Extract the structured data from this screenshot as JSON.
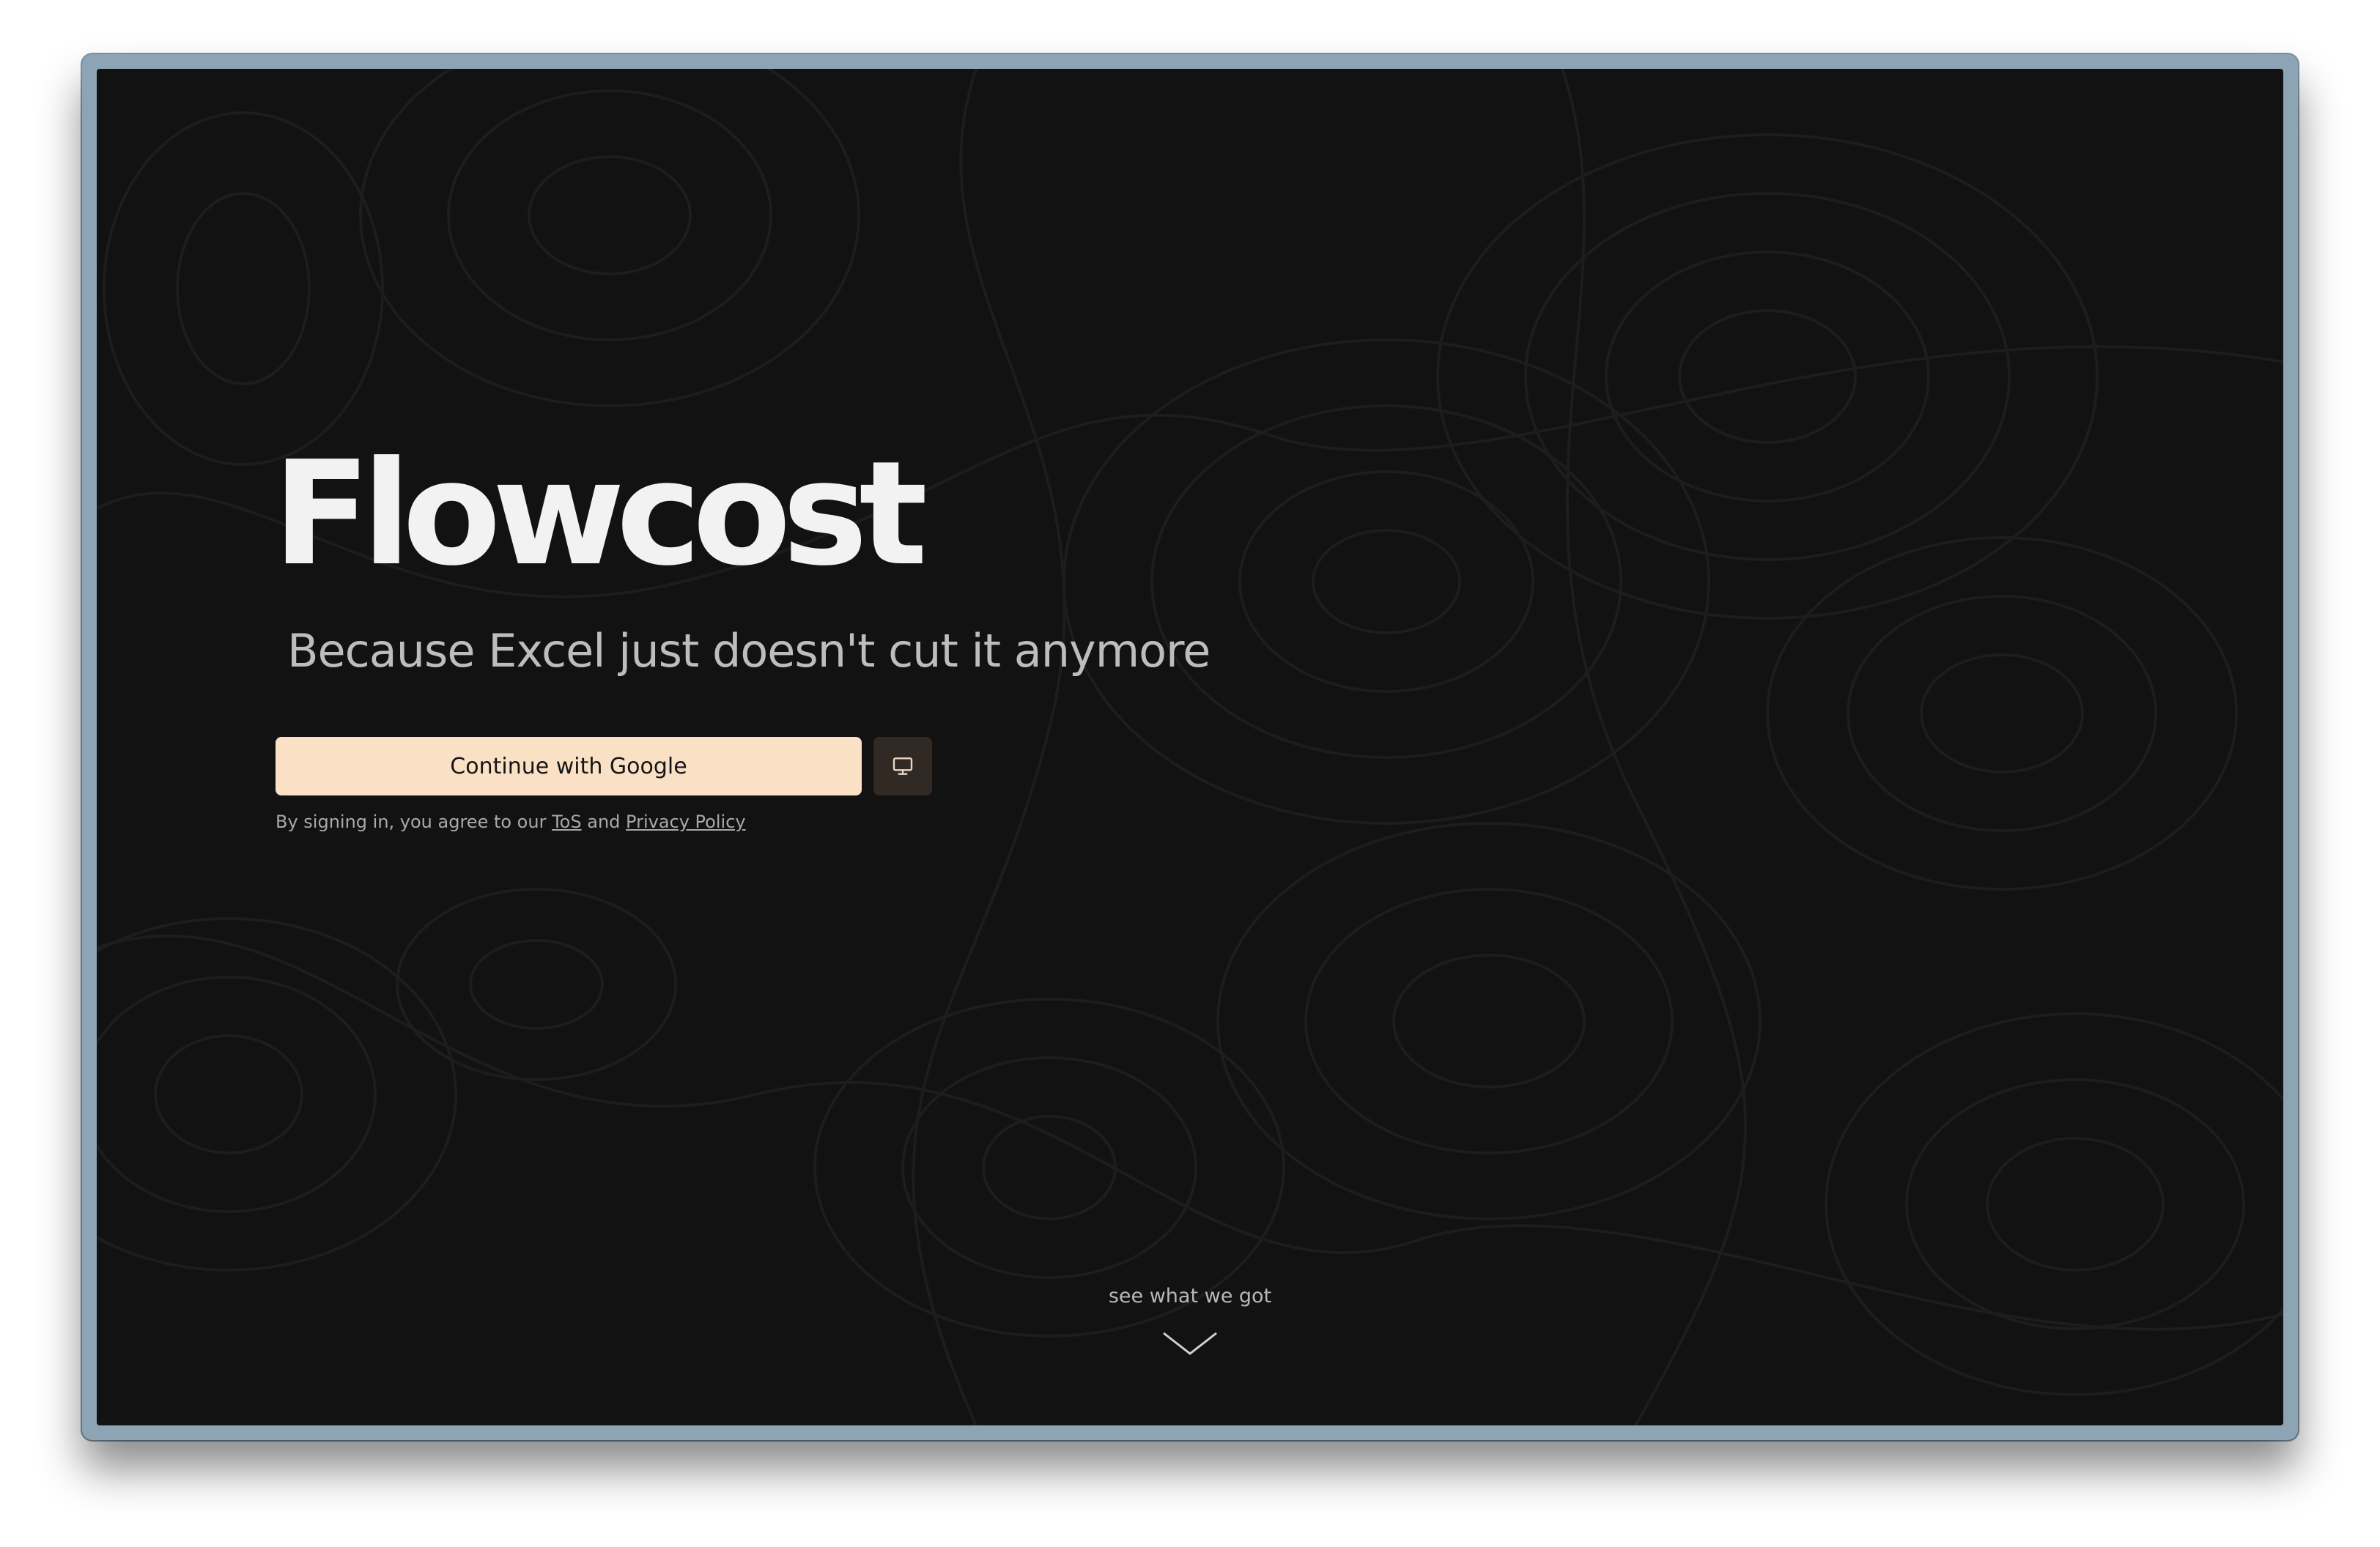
{
  "hero": {
    "title": "Flowcost",
    "subtitle": "Because Excel just doesn't cut it anymore"
  },
  "auth": {
    "google_button_label": "Continue with Google",
    "device_button_icon": "monitor-icon",
    "legal_prefix": "By signing in, you agree to our",
    "tos_label": "ToS",
    "legal_joiner": "and",
    "privacy_label": "Privacy Policy"
  },
  "scroll_hint": {
    "label": "see what we got",
    "icon": "chevron-down-icon"
  },
  "colors": {
    "background": "#121212",
    "frame": "#8ca4b4",
    "title": "#f2f2f2",
    "subtitle": "#bdbdbd",
    "primary_button": "#fae1c6",
    "secondary_button": "#302924",
    "contour_lines": "#1f1f1f"
  }
}
